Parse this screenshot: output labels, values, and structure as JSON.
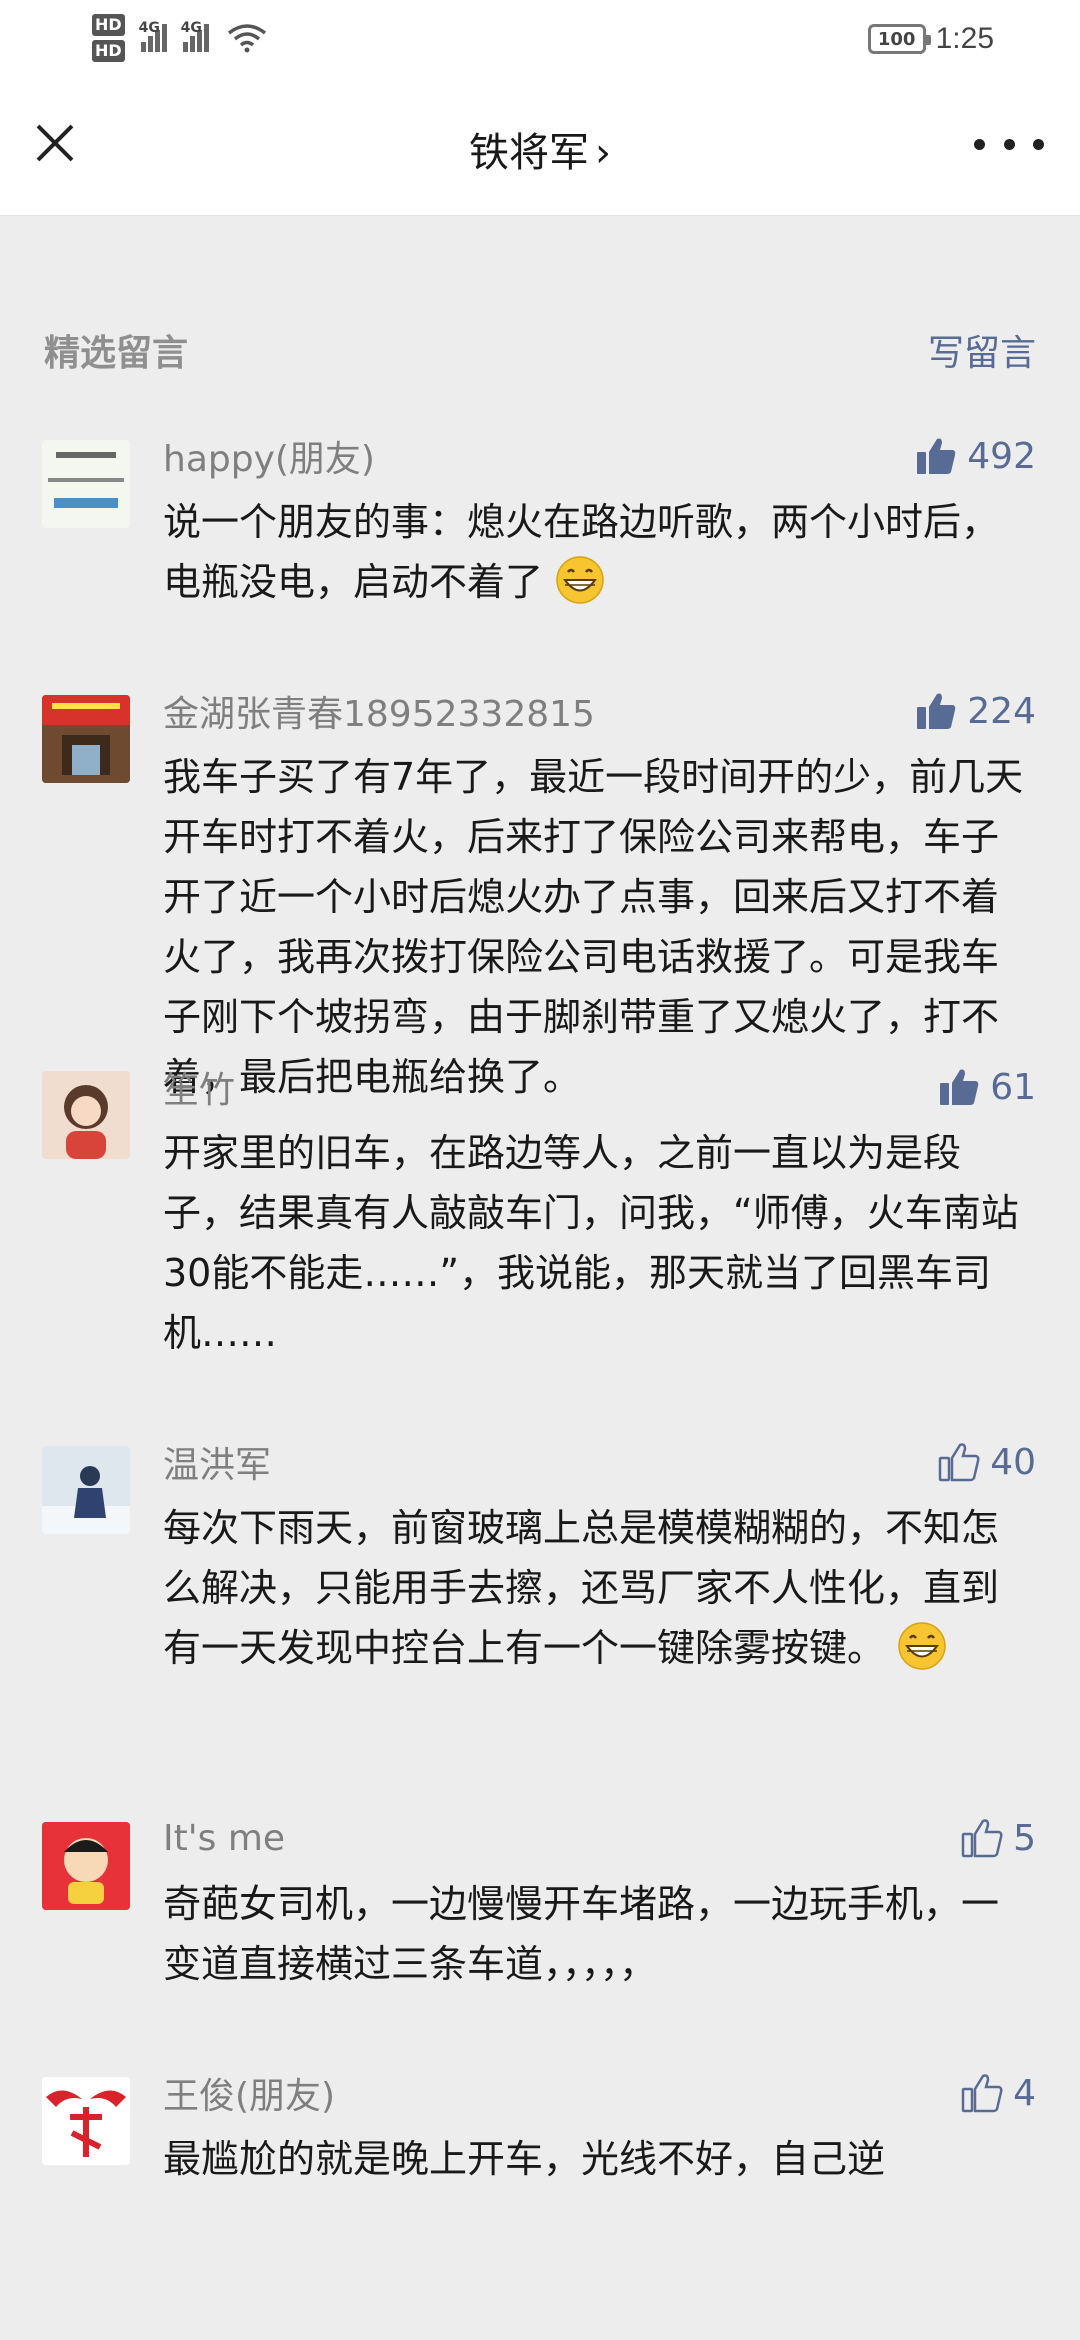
{
  "status_bar": {
    "hd1": "HD",
    "hd2": "HD",
    "net1": "4G",
    "net2": "4G",
    "battery": "100",
    "time": "1:25"
  },
  "header": {
    "title": "铁将军",
    "chevron": "›"
  },
  "section": {
    "title": "精选留言",
    "write_label": "写留言"
  },
  "icons": {
    "close": "close-icon",
    "more": "more-icon",
    "like": "thumbs-up-icon",
    "emoji": "grin-emoji-icon"
  },
  "colors": {
    "link": "#576b95",
    "background": "#ededed",
    "name": "#7f7f7f"
  },
  "comments": [
    {
      "name": "happy(朋友)",
      "likes": "492",
      "liked": true,
      "text": "说一个朋友的事：熄火在路边听歌，两个小时后，电瓶没电，启动不着了",
      "emoji": true
    },
    {
      "name": "金湖张青春18952332815",
      "likes": "224",
      "liked": true,
      "text": "我车子买了有7年了，最近一段时间开的少，前几天开车时打不着火，后来打了保险公司来帮电，车子开了近一个小时后熄火办了点事，回来后又打不着火了，我再次拨打保险公司电话救援了。可是我车子刚下个坡拐弯，由于脚刹带重了又熄火了，打不着，最后把电瓶给换了。",
      "emoji": false
    },
    {
      "name": "笙竹",
      "likes": "61",
      "liked": true,
      "text": "开家里的旧车，在路边等人，之前一直以为是段子，结果真有人敲敲车门，问我，“师傅，火车南站30能不能走……”，我说能，那天就当了回黑车司机……",
      "emoji": false
    },
    {
      "name": "温洪军",
      "likes": "40",
      "liked": false,
      "text": "每次下雨天，前窗玻璃上总是模模糊糊的，不知怎么解决，只能用手去擦，还骂厂家不人性化，直到有一天发现中控台上有一个一键除雾按键。",
      "emoji": true
    },
    {
      "name": "It's me",
      "likes": "5",
      "liked": false,
      "text": "奇葩女司机，一边慢慢开车堵路，一边玩手机，一变道直接横过三条车道，，，，，",
      "emoji": false
    },
    {
      "name": "王俊(朋友)",
      "likes": "4",
      "liked": false,
      "text": "最尴尬的就是晚上开车，光线不好，自己逆",
      "emoji": false
    }
  ]
}
